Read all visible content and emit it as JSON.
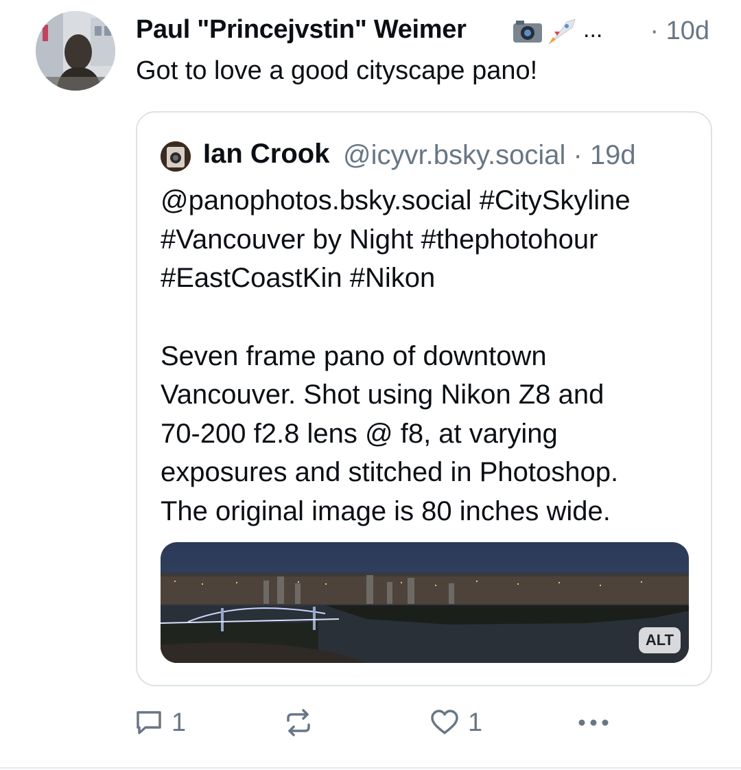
{
  "post": {
    "author_name": "Paul \"Princejvstin\" Weimer",
    "truncation": "...",
    "time": "· 10d",
    "text": "Got to love a good cityscape pano!"
  },
  "quote": {
    "author_name": "Ian Crook",
    "handle": "@icyvr.bsky.social · 19d",
    "text_1": "@panophotos.bsky.social #CitySkyline\n#Vancouver by Night #thephotohour\n#EastCoastKin #Nikon",
    "text_2": "Seven frame pano of downtown\nVancouver. Shot using Nikon Z8 and\n70-200 f2.8 lens @ f8, at varying\nexposures and stitched in Photoshop.\nThe original image is 80 inches wide.",
    "image_alt_badge": "ALT"
  },
  "actions": {
    "reply_count": "1",
    "like_count": "1"
  },
  "icons": {
    "reply": "speech-bubble-icon",
    "repost": "repost-arrows-icon",
    "like": "heart-icon",
    "more": "more-dots-icon"
  },
  "colors": {
    "muted": "#687684",
    "text": "#0b0f14",
    "card_border": "#dce2e8"
  }
}
